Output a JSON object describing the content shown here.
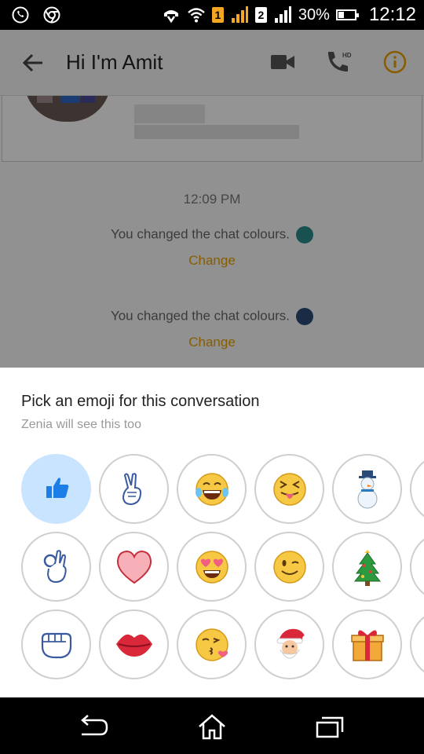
{
  "status_bar": {
    "sim1": "1",
    "sim2": "2",
    "battery": "30%",
    "battery_level": 0.3,
    "time": "12:12",
    "icons": [
      "whatsapp-icon",
      "chrome-icon",
      "headset-icon",
      "wifi-icon",
      "signal-icon",
      "battery-icon"
    ]
  },
  "app_bar": {
    "title": "Hi I'm Amit",
    "icons": [
      "back-arrow-icon",
      "video-call-icon",
      "hd-call-icon",
      "info-icon"
    ],
    "accent": "#e8a000"
  },
  "chat": {
    "timestamp": "12:09 PM",
    "messages": [
      {
        "text": "You changed the chat colours.",
        "dot_color": "#2a8c88",
        "action": "Change"
      },
      {
        "text": "You changed the chat colours.",
        "dot_color": "#2b4a78",
        "action": "Change"
      }
    ]
  },
  "sheet": {
    "title": "Pick an emoji for this conversation",
    "subtitle": "Zenia will see this too",
    "emojis": [
      [
        "thumbs-up",
        "victory-hand",
        "tears-of-joy",
        "squinting-tongue",
        "snowman",
        "more"
      ],
      [
        "ok-hand",
        "red-heart",
        "heart-eyes",
        "winking-face",
        "christmas-tree",
        "more"
      ],
      [
        "fist",
        "lips",
        "kissing-heart",
        "santa",
        "gift",
        "more"
      ]
    ],
    "selected": "thumbs-up",
    "selected_color": "#c9e4ff"
  },
  "nav_bar": {
    "icons": [
      "back-icon",
      "home-icon",
      "recents-icon"
    ]
  }
}
